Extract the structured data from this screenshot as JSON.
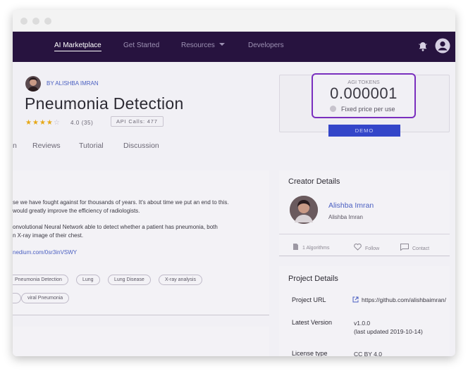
{
  "nav": {
    "items": [
      "AI Marketplace",
      "Get Started",
      "Resources",
      "Developers"
    ],
    "active": "AI Marketplace"
  },
  "service": {
    "author": "BY ALISHBA IMRAN",
    "title": "Pneumonia Detection",
    "rating_value": 4,
    "rating_max": 5,
    "rating_text": "4.0 (35)",
    "api_calls": "API Calls: 477"
  },
  "tabs": [
    "n",
    "Reviews",
    "Tutorial",
    "Discussion"
  ],
  "description": {
    "lines": [
      "se we have fought against for thousands of years. It's about time we put an end to this.",
      " would greatly improve the efficiency of radiologists.",
      "onvolutional Neural Network able to detect whether a patient has pneumonia, both",
      "n X-ray image of their chest."
    ],
    "link": "nedium.com/0sr3inVSWY",
    "tags": [
      "Pneumonia Detection",
      "Lung",
      "Lung Disease",
      "X-ray analysis",
      "",
      "viral Pneumonia"
    ]
  },
  "pricing": {
    "label": "AGI TOKENS",
    "price": "0.000001",
    "fixed": "Fixed price per use",
    "demo_button": "DEMO"
  },
  "creator": {
    "section_title": "Creator Details",
    "name": "Alishba Imran",
    "subtitle": "Alishba Imran",
    "actions": [
      "1 Algorithms",
      "Follow",
      "Contact"
    ]
  },
  "project": {
    "section_title": "Project Details",
    "url_label": "Project URL",
    "url": "https://github.com/alishbaimran/",
    "version_label": "Latest Version",
    "version": "v1.0.0",
    "version_updated": "(last updated 2019-10-14)",
    "license_label": "License type",
    "license": "CC BY 4.0"
  },
  "colors": {
    "nav_bg": "#27133f",
    "accent_link": "#4a5fc1",
    "popup_border": "#7a2fbe",
    "star": "#e6a817",
    "demo_button": "#3446c9"
  }
}
